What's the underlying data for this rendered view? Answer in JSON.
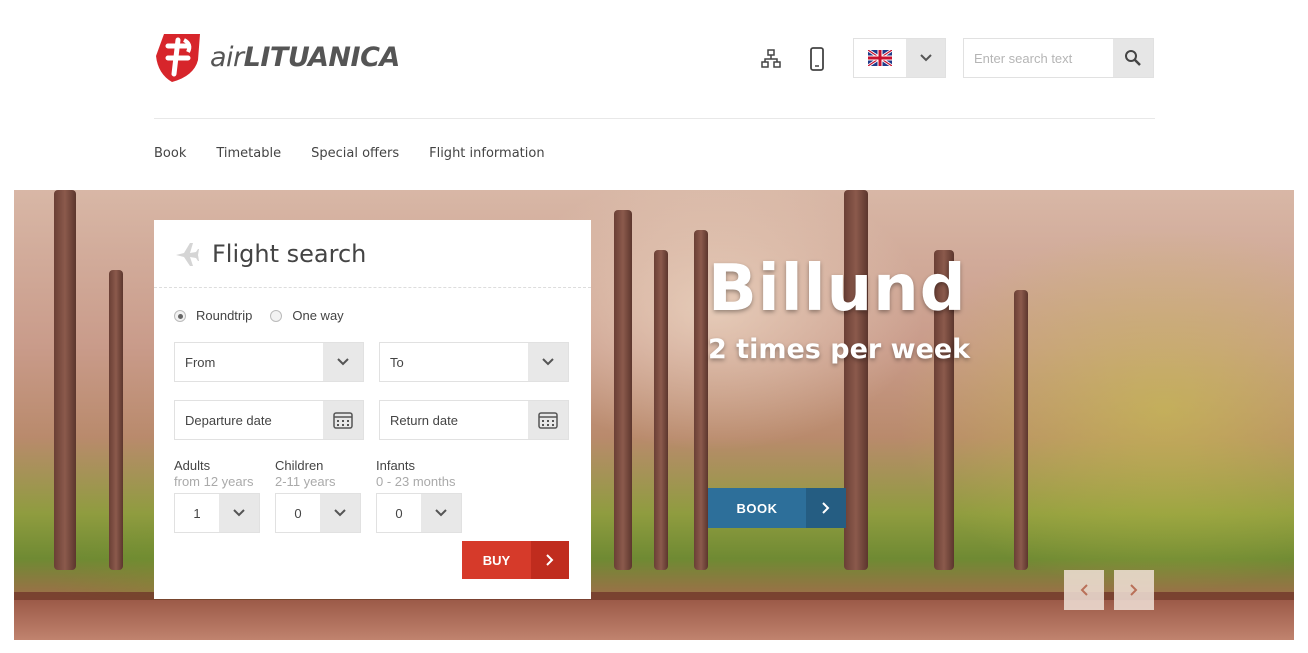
{
  "brand": {
    "prefix": "air",
    "name": "LITUANICA"
  },
  "header": {
    "search_placeholder": "Enter search text"
  },
  "nav": [
    "Book",
    "Timetable",
    "Special offers",
    "Flight information"
  ],
  "promo": {
    "title": "Billund",
    "subtitle": "2 times per week",
    "button": "BOOK"
  },
  "flight_search": {
    "title": "Flight search",
    "trip_types": [
      "Roundtrip",
      "One way"
    ],
    "selected_trip": "Roundtrip",
    "from": "From",
    "to": "To",
    "departure": "Departure date",
    "return": "Return date",
    "adults": {
      "label": "Adults",
      "hint": "from 12 years",
      "value": "1"
    },
    "children": {
      "label": "Children",
      "hint": "2-11 years",
      "value": "0"
    },
    "infants": {
      "label": "Infants",
      "hint": "0 - 23 months",
      "value": "0"
    },
    "buy": "BUY"
  },
  "colors": {
    "accent": "#d63a2a",
    "promo_button": "#2d6f9a",
    "logo": "#d7252b"
  }
}
